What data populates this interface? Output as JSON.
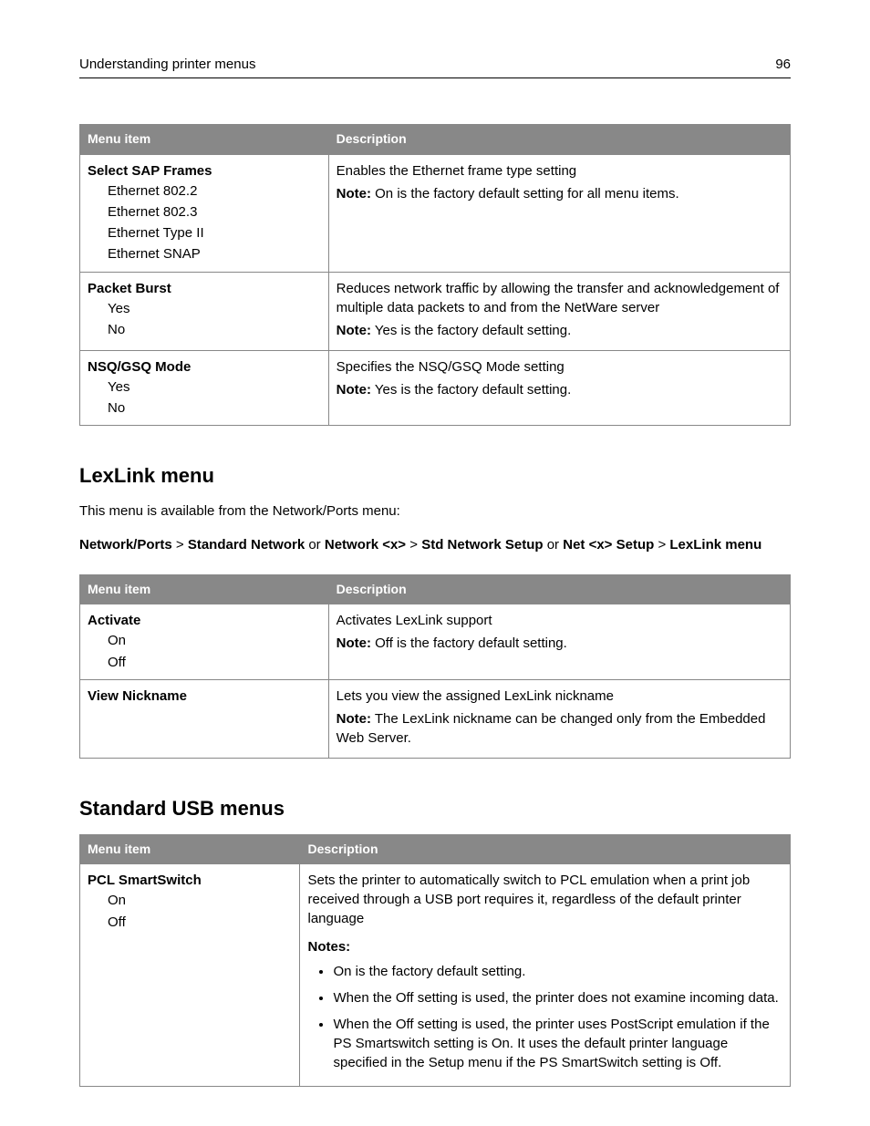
{
  "header": {
    "title": "Understanding printer menus",
    "page": "96"
  },
  "table1": {
    "h1": "Menu item",
    "h2": "Description",
    "rows": [
      {
        "title": "Select SAP Frames",
        "subs": [
          "Ethernet 802.2",
          "Ethernet 802.3",
          "Ethernet Type II",
          "Ethernet SNAP"
        ],
        "desc1": "Enables the Ethernet frame type setting",
        "noteLabel": "Note:",
        "note": " On is the factory default setting for all menu items."
      },
      {
        "title": "Packet Burst",
        "subs": [
          "Yes",
          "No"
        ],
        "desc1": "Reduces network traffic by allowing the transfer and acknowledgement of multiple data packets to and from the NetWare server",
        "noteLabel": "Note:",
        "note": " Yes is the factory default setting."
      },
      {
        "title": "NSQ/GSQ Mode",
        "subs": [
          "Yes",
          "No"
        ],
        "desc1": "Specifies the NSQ/GSQ Mode setting",
        "noteLabel": "Note:",
        "note": " Yes is the factory default setting."
      }
    ]
  },
  "section2": {
    "heading": "LexLink menu",
    "intro": "This menu is available from the Network/Ports menu:",
    "path": {
      "p1": "Network/Ports",
      "s1": " > ",
      "p2": "Standard Network",
      "s2": " or ",
      "p3": "Network <x>",
      "s3": " > ",
      "p4": "Std Network Setup",
      "s4": " or ",
      "p5": "Net <x> Setup",
      "s5": " > ",
      "p6": "LexLink menu"
    }
  },
  "table2": {
    "h1": "Menu item",
    "h2": "Description",
    "rows": [
      {
        "title": "Activate",
        "subs": [
          "On",
          "Off"
        ],
        "desc1": "Activates LexLink support",
        "noteLabel": "Note:",
        "note": " Off is the factory default setting."
      },
      {
        "title": "View Nickname",
        "subs": [],
        "desc1": "Lets you view the assigned LexLink nickname",
        "noteLabel": "Note:",
        "note": " The LexLink nickname can be changed only from the Embedded Web Server."
      }
    ]
  },
  "section3": {
    "heading": "Standard USB menus"
  },
  "table3": {
    "h1": "Menu item",
    "h2": "Description",
    "row": {
      "title": "PCL SmartSwitch",
      "subs": [
        "On",
        "Off"
      ],
      "desc1": "Sets the printer to automatically switch to PCL emulation when a print job received through a USB port requires it, regardless of the default printer language",
      "notesLabel": "Notes:",
      "bullets": [
        "On is the factory default setting.",
        "When the Off setting is used, the printer does not examine incoming data.",
        "When the Off setting is used, the printer uses PostScript emulation if the PS Smartswitch setting is On. It uses the default printer language specified in the Setup menu if the PS SmartSwitch setting is Off."
      ]
    }
  }
}
